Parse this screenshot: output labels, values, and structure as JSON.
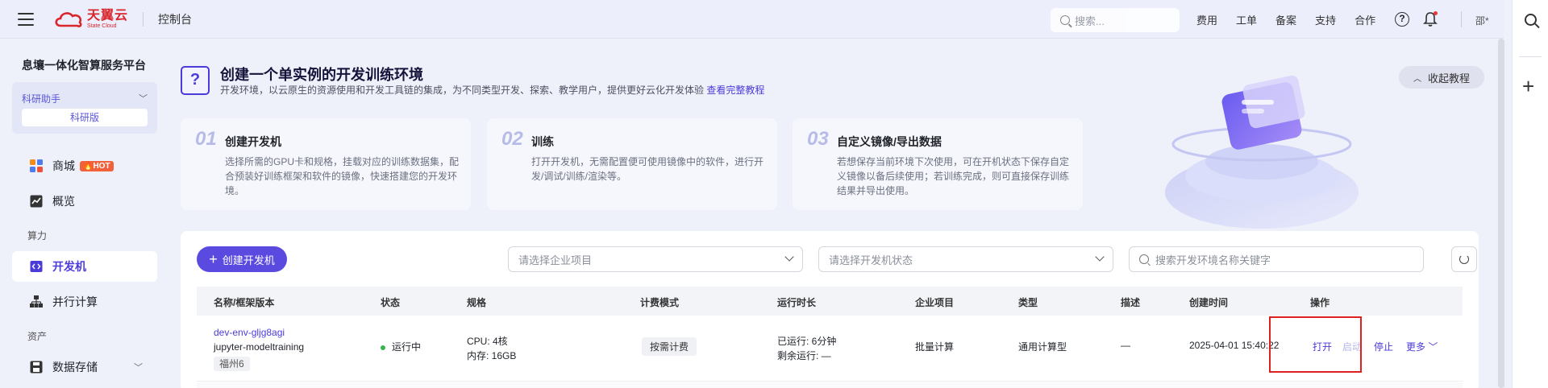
{
  "header": {
    "brand_cn": "天翼云",
    "brand_en": "State Cloud",
    "console": "控制台",
    "search_placeholder": "搜索...",
    "links": [
      "费用",
      "工单",
      "备案",
      "支持",
      "合作"
    ],
    "help": "?",
    "user": "邵*"
  },
  "sidebar": {
    "platform_title": "息壤一体化智算服务平台",
    "assistant_label": "科研助手",
    "assistant_edition": "科研版",
    "items": [
      {
        "label": "商城",
        "badge": "HOT"
      },
      {
        "label": "概览"
      }
    ],
    "group_compute": "算力",
    "compute_items": [
      {
        "label": "开发机",
        "active": true
      },
      {
        "label": "并行计算"
      }
    ],
    "group_assets": "资产",
    "asset_items": [
      {
        "label": "数据存储"
      }
    ]
  },
  "banner": {
    "icon": "?",
    "title": "创建一个单实例的开发训练环境",
    "desc": "开发环境，以云原生的资源使用和开发工具链的集成，为不同类型开发、探索、教学用户，提供更好云化开发体验",
    "link": "查看完整教程",
    "collapse_label": "收起教程"
  },
  "steps": [
    {
      "num": "01",
      "title": "创建开发机",
      "desc": "选择所需的GPU卡和规格，挂载对应的训练数据集，配合预装好训练框架和软件的镜像，快速搭建您的开发环境。"
    },
    {
      "num": "02",
      "title": "训练",
      "desc": "打开开发机，无需配置便可使用镜像中的软件，进行开发/调试/训练/渲染等。"
    },
    {
      "num": "03",
      "title": "自定义镜像/导出数据",
      "desc": "若想保存当前环境下次使用，可在开机状态下保存自定义镜像以备后续使用；若训练完成，则可直接保存训练结果并导出使用。"
    }
  ],
  "toolbar": {
    "create_label": "创建开发机",
    "project_placeholder": "请选择企业项目",
    "status_placeholder": "请选择开发机状态",
    "search_placeholder": "搜索开发环境名称关键字"
  },
  "table": {
    "columns": [
      "名称/框架版本",
      "状态",
      "规格",
      "计费模式",
      "运行时长",
      "企业项目",
      "类型",
      "描述",
      "创建时间",
      "操作"
    ],
    "rows": [
      {
        "name": "dev-env-gljg8agi",
        "framework": "jupyter-modeltraining",
        "region": "福州6",
        "status": "运行中",
        "cpu": "CPU: 4核",
        "mem": "内存: 16GB",
        "billing": "按需计费",
        "ran": "已运行: 6分钟",
        "remain": "剩余运行: —",
        "project": "批量计算",
        "type": "通用计算型",
        "desc": "—",
        "created": "2025-04-01 15:40:22",
        "ops": {
          "open": "打开",
          "start": "启动",
          "stop": "停止",
          "more": "更多"
        }
      }
    ]
  },
  "colors": {
    "accent": "#5b4ae0",
    "brand_red": "#d8262c",
    "running": "#3cb24b",
    "highlight_box": "#e02020"
  }
}
